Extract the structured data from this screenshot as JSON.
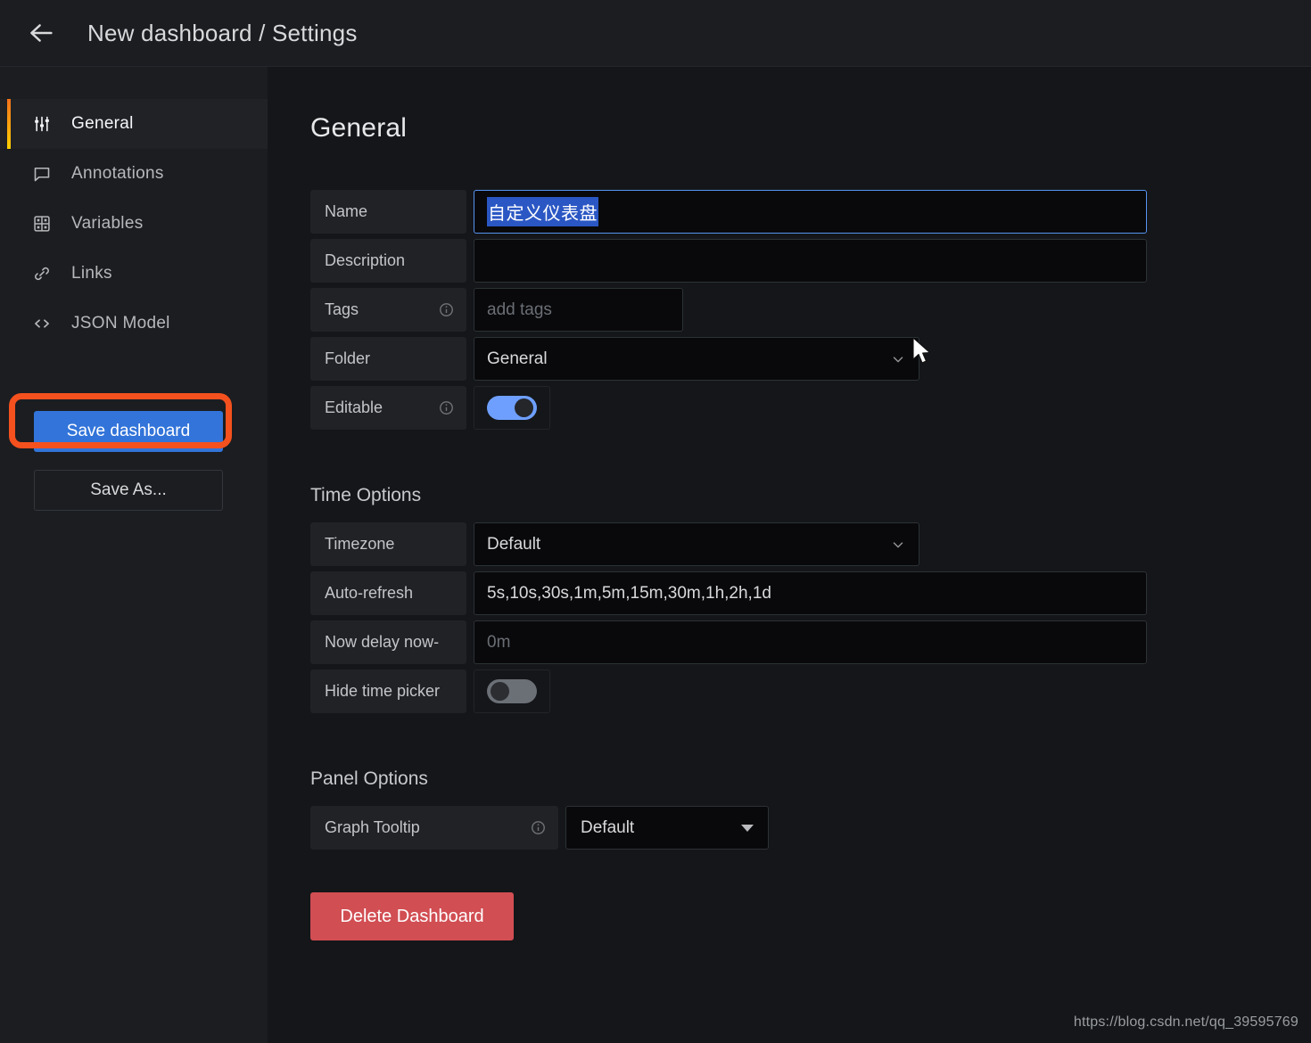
{
  "topbar": {
    "back_icon": "arrow-left-icon",
    "title": "New dashboard / Settings"
  },
  "sidebar": {
    "items": [
      {
        "label": "General",
        "icon": "sliders-icon",
        "active": true
      },
      {
        "label": "Annotations",
        "icon": "comment-icon",
        "active": false
      },
      {
        "label": "Variables",
        "icon": "grid-icon",
        "active": false
      },
      {
        "label": "Links",
        "icon": "link-icon",
        "active": false
      },
      {
        "label": "JSON Model",
        "icon": "code-icon",
        "active": false
      }
    ],
    "save_dashboard_label": "Save dashboard",
    "save_as_label": "Save As...",
    "highlight_color": "#f4511e"
  },
  "main": {
    "page_title": "General",
    "general": {
      "name": {
        "label": "Name",
        "value": "自定义仪表盘",
        "selected": true
      },
      "description": {
        "label": "Description",
        "value": "",
        "placeholder": ""
      },
      "tags": {
        "label": "Tags",
        "value": "",
        "placeholder": "add tags",
        "info_icon": "info-circle-icon"
      },
      "folder": {
        "label": "Folder",
        "value": "General",
        "chevron": "chevron-down-icon"
      },
      "editable": {
        "label": "Editable",
        "state": "on",
        "info_icon": "info-circle-icon"
      }
    },
    "time_options": {
      "title": "Time Options",
      "timezone": {
        "label": "Timezone",
        "value": "Default",
        "chevron": "chevron-down-icon"
      },
      "auto_refresh": {
        "label": "Auto-refresh",
        "value": "5s,10s,30s,1m,5m,15m,30m,1h,2h,1d"
      },
      "now_delay": {
        "label": "Now delay now-",
        "value": "",
        "placeholder": "0m"
      },
      "hide_time_picker": {
        "label": "Hide time picker",
        "state": "off"
      }
    },
    "panel_options": {
      "title": "Panel Options",
      "graph_tooltip": {
        "label": "Graph Tooltip",
        "value": "Default",
        "info_icon": "info-circle-icon"
      }
    },
    "delete_label": "Delete Dashboard"
  },
  "watermark": "https://blog.csdn.net/qq_39595769",
  "colors": {
    "accent_blue": "#3274d9",
    "danger_red": "#d14e53",
    "highlight_orange": "#f4511e",
    "toggle_on": "#6e9fff",
    "selection_blue": "#2b57c4"
  }
}
